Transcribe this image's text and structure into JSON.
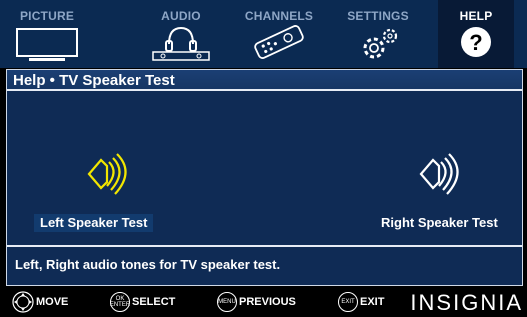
{
  "nav": {
    "tabs": [
      {
        "label": "PICTURE",
        "icon": "tv-icon",
        "active": false
      },
      {
        "label": "AUDIO",
        "icon": "speaker-icon",
        "active": false
      },
      {
        "label": "CHANNELS",
        "icon": "remote-icon",
        "active": false
      },
      {
        "label": "SETTINGS",
        "icon": "gear-icon",
        "active": false
      },
      {
        "label": "HELP",
        "icon": "help-icon",
        "active": true
      }
    ]
  },
  "panel": {
    "title": "Help • TV Speaker Test",
    "left_label": "Left Speaker Test",
    "right_label": "Right Speaker Test",
    "description": "Left, Right audio tones for TV speaker test."
  },
  "footer": {
    "move": "MOVE",
    "select": "SELECT",
    "previous": "PREVIOUS",
    "exit": "EXIT",
    "ok_key": "OK ENTER",
    "menu_key": "MENU",
    "exit_key": "EXIT",
    "brand": "INSIGNIA"
  },
  "colors": {
    "nav_bg": "#0b2a52",
    "panel_bg": "#0f2b55",
    "accent_yellow": "#f2e600",
    "inactive_text": "#8ea6c6"
  }
}
